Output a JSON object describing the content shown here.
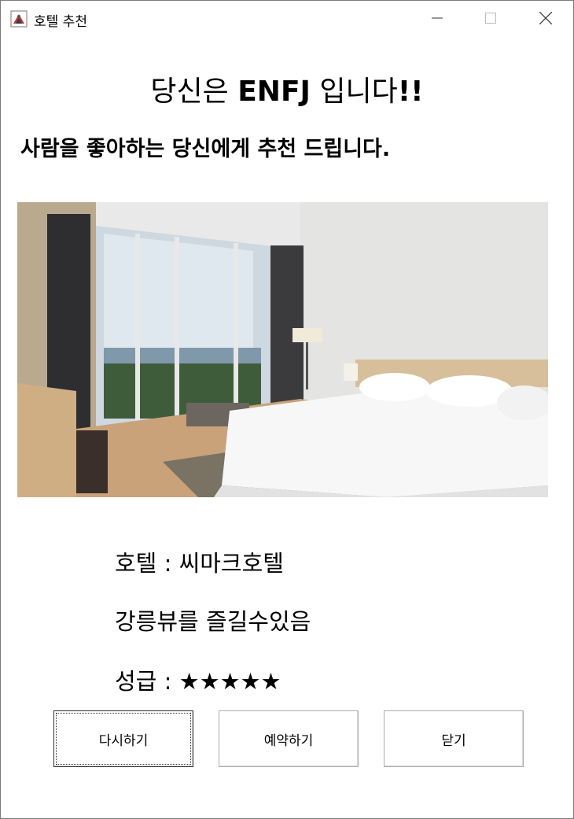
{
  "window": {
    "title": "호텔 추천",
    "controls": {
      "minimize_icon": "minimize-icon",
      "maximize_icon": "maximize-icon",
      "close_icon": "close-icon"
    }
  },
  "result": {
    "prefix": "당신은 ",
    "type": "ENFJ",
    "suffix_text": " 입니다",
    "exclaim": "!!"
  },
  "subtitle": "사람을 좋아하는 당신에게 추천 드립니다.",
  "hotel": {
    "name_line": "호텔 : 씨마크호텔",
    "description": "강릉뷰를 즐길수있음",
    "rating_line": "성급 : ★★★★★",
    "rating_value": 5,
    "rating_max": 5
  },
  "buttons": {
    "retry": "다시하기",
    "reserve": "예약하기",
    "close": "닫기"
  }
}
